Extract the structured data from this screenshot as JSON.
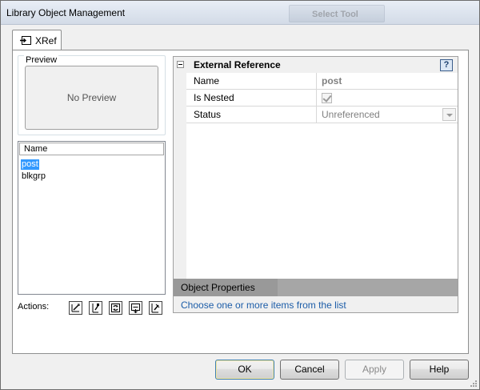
{
  "window": {
    "title": "Library Object Management",
    "background_tab": "Select Tool"
  },
  "tabs": [
    {
      "label": "XRef",
      "icon": "xref-icon"
    }
  ],
  "preview": {
    "legend": "Preview",
    "placeholder": "No Preview"
  },
  "list": {
    "header": "Name",
    "items": [
      {
        "label": "post",
        "selected": true
      },
      {
        "label": "blkgrp",
        "selected": false
      }
    ]
  },
  "actions": {
    "label": "Actions:",
    "icons": [
      "action-edit-icon",
      "action-add-icon",
      "action-reload-icon",
      "action-save-icon",
      "action-detach-icon"
    ]
  },
  "properties": {
    "category": "External Reference",
    "help": "?",
    "rows": [
      {
        "name": "Name",
        "value": "post"
      },
      {
        "name": "Is Nested",
        "value": "",
        "checked": true
      },
      {
        "name": "Status",
        "value": "Unreferenced"
      }
    ],
    "description_title": "Object Properties",
    "description_text": "Choose one or more items from the list"
  },
  "buttons": {
    "ok": "OK",
    "cancel": "Cancel",
    "apply": "Apply",
    "help": "Help"
  },
  "colors": {
    "selection": "#3399ff",
    "link_text": "#1c5da8",
    "description_bar": "#a6a6a6"
  }
}
